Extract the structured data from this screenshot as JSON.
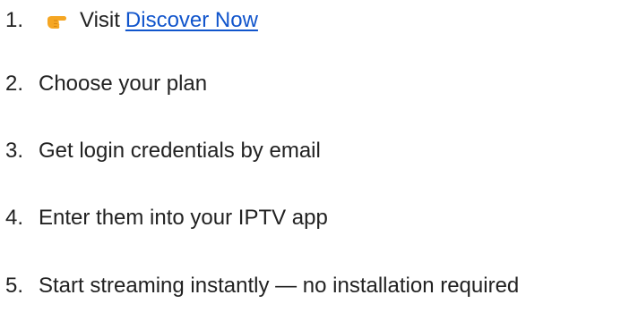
{
  "steps": [
    {
      "number": "1.",
      "prefix": "Visit",
      "link_text": "Discover Now",
      "icon": "pointing-hand-icon"
    },
    {
      "number": "2.",
      "text": "Choose your plan"
    },
    {
      "number": "3.",
      "text": "Get login credentials by email"
    },
    {
      "number": "4.",
      "text": "Enter them into your IPTV app"
    },
    {
      "number": "5.",
      "text": "Start streaming instantly — no installation required"
    }
  ],
  "colors": {
    "text": "#222222",
    "link": "#1155cc",
    "icon": "#f5a623"
  }
}
